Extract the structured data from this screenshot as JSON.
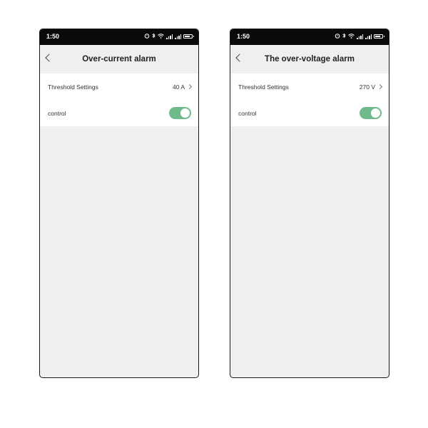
{
  "screens": [
    {
      "status": {
        "time": "1:50"
      },
      "title": "Over-current alarm",
      "rows": {
        "threshold": {
          "label": "Threshold Settings",
          "value": "40 A"
        },
        "control": {
          "label": "control",
          "enabled": true
        }
      }
    },
    {
      "status": {
        "time": "1:50"
      },
      "title": "The over-voltage alarm",
      "rows": {
        "threshold": {
          "label": "Threshold Settings",
          "value": "270 V"
        },
        "control": {
          "label": "control",
          "enabled": true
        }
      }
    }
  ],
  "colors": {
    "toggle_on": "#6fba8a",
    "status_bar": "#0a0a0a",
    "page_background": "#efefef"
  }
}
